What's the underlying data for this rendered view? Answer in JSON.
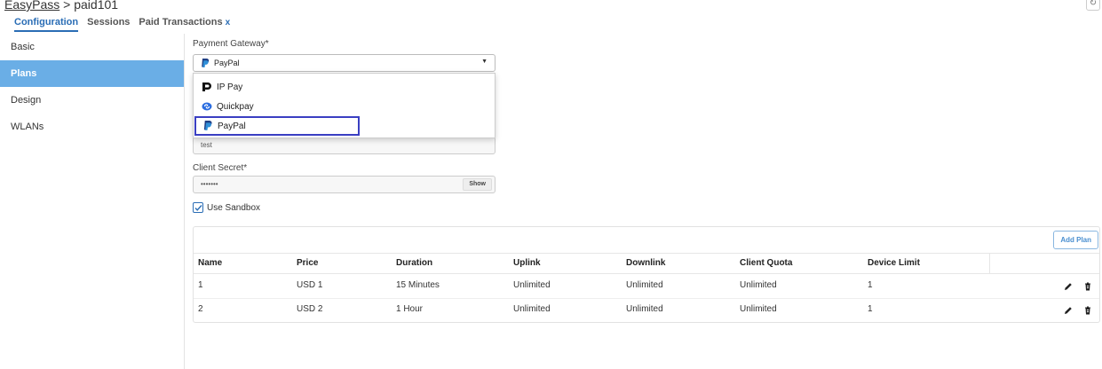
{
  "breadcrumb": {
    "root": "EasyPass",
    "separator": " > ",
    "current": "paid101"
  },
  "tabs": [
    {
      "label": "Configuration"
    },
    {
      "label": "Sessions"
    },
    {
      "label": "Paid Transactions",
      "close": "x"
    }
  ],
  "sidebar": {
    "items": [
      {
        "label": "Basic"
      },
      {
        "label": "Plans"
      },
      {
        "label": "Design"
      },
      {
        "label": "WLANs"
      }
    ]
  },
  "form": {
    "gateway_label": "Payment Gateway*",
    "gateway_value": "PayPal",
    "gateway_options": [
      "IP Pay",
      "Quickpay",
      "PayPal"
    ],
    "client_id_value": "test",
    "client_secret_label": "Client Secret*",
    "client_secret_value": "•••••••",
    "show_label": "Show",
    "sandbox_label": "Use Sandbox"
  },
  "table": {
    "add_plan_label": "Add Plan",
    "columns": [
      "Name",
      "Price",
      "Duration",
      "Uplink",
      "Downlink",
      "Client Quota",
      "Device Limit"
    ],
    "rows": [
      [
        "1",
        "USD 1",
        "15 Minutes",
        "Unlimited",
        "Unlimited",
        "Unlimited",
        "1"
      ],
      [
        "2",
        "USD 2",
        "1 Hour",
        "Unlimited",
        "Unlimited",
        "Unlimited",
        "1"
      ]
    ]
  },
  "colors": {
    "accent": "#2a6db5",
    "sidebar_active": "#6aaee6",
    "highlight_border": "#3a3fc2"
  }
}
